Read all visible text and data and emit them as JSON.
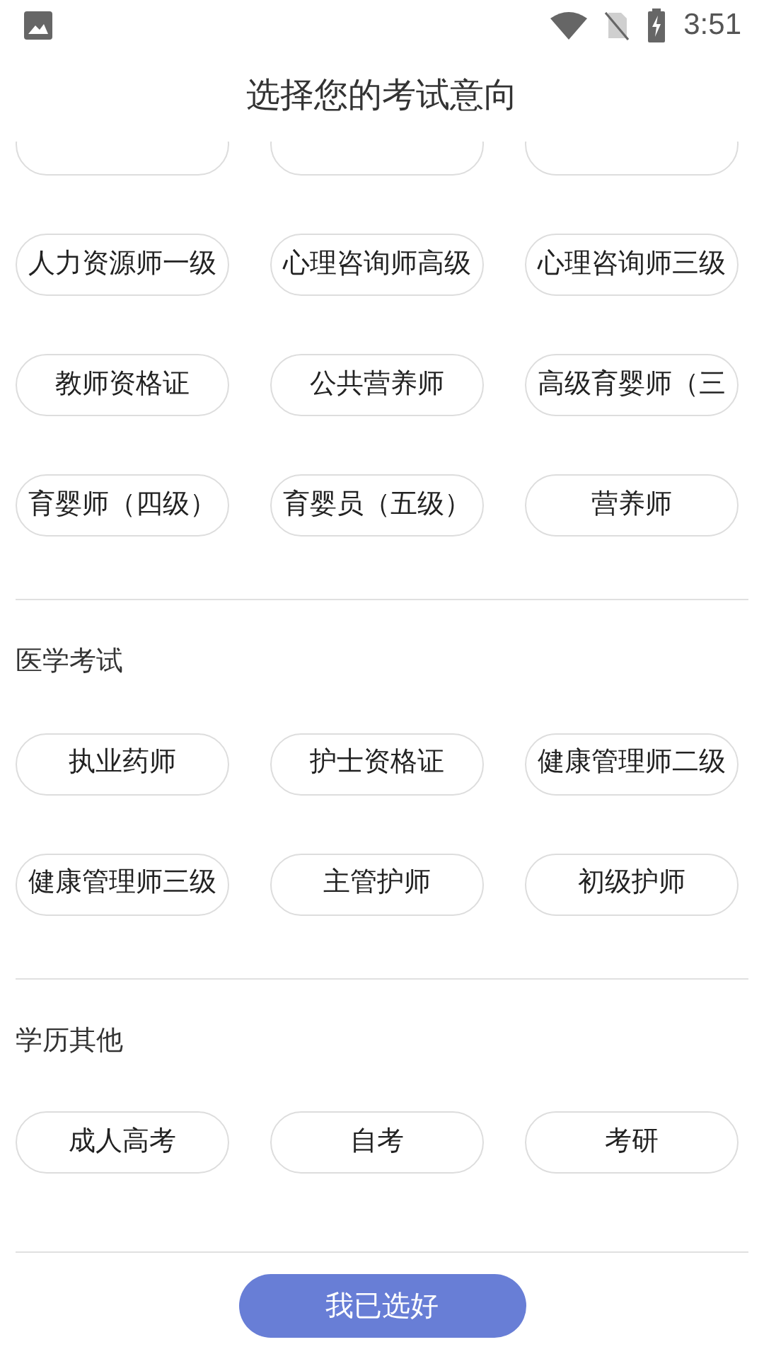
{
  "status_bar": {
    "time": "3:51"
  },
  "title": "选择您的考试意向",
  "sections": [
    {
      "items": [
        {
          "kind": "clipped"
        },
        {
          "kind": "clipped"
        },
        {
          "kind": "clipped"
        },
        {
          "kind": "option",
          "label": "人力资源师一级",
          "selected": false
        },
        {
          "kind": "option",
          "label": "心理咨询师高级",
          "selected": false
        },
        {
          "kind": "option",
          "label": "心理咨询师三级",
          "selected": false
        },
        {
          "kind": "option",
          "label": "教师资格证",
          "selected": false
        },
        {
          "kind": "option",
          "label": "公共营养师",
          "selected": false
        },
        {
          "kind": "option",
          "label": "高级育婴师（三",
          "selected": false
        },
        {
          "kind": "option",
          "label": "育婴师（四级）",
          "selected": false
        },
        {
          "kind": "option",
          "label": "育婴员（五级）",
          "selected": false
        },
        {
          "kind": "option",
          "label": "营养师",
          "selected": false
        }
      ]
    },
    {
      "title": "医学考试",
      "items": [
        {
          "kind": "option",
          "label": "执业药师",
          "selected": false
        },
        {
          "kind": "option",
          "label": "护士资格证",
          "selected": false
        },
        {
          "kind": "option",
          "label": "健康管理师二级",
          "selected": false
        },
        {
          "kind": "option",
          "label": "健康管理师三级",
          "selected": false
        },
        {
          "kind": "option",
          "label": "主管护师",
          "selected": false
        },
        {
          "kind": "option",
          "label": "初级护师",
          "selected": false
        }
      ]
    },
    {
      "title": "学历其他",
      "items": [
        {
          "kind": "option",
          "label": "成人高考",
          "selected": false
        },
        {
          "kind": "option",
          "label": "自考",
          "selected": false
        },
        {
          "kind": "option",
          "label": "考研",
          "selected": false
        }
      ]
    }
  ],
  "confirm_button": "我已选好"
}
